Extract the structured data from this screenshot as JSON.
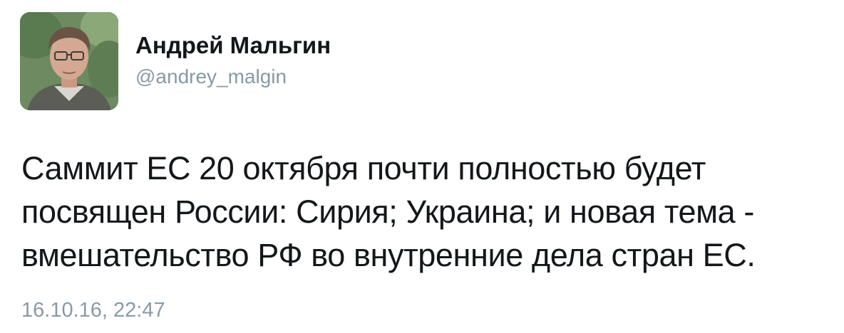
{
  "tweet": {
    "author": {
      "display_name": "Андрей Мальгин",
      "handle": "@andrey_malgin"
    },
    "text": "Саммит ЕС 20 октября почти полностью будет\nпосвящен России: Сирия; Украина; и новая тема -\nвмешательство РФ во внутренние дела стран ЕС.",
    "timestamp": "16.10.16, 22:47"
  },
  "colors": {
    "name": "#14171a",
    "muted": "#8899a6",
    "background": "#ffffff"
  }
}
